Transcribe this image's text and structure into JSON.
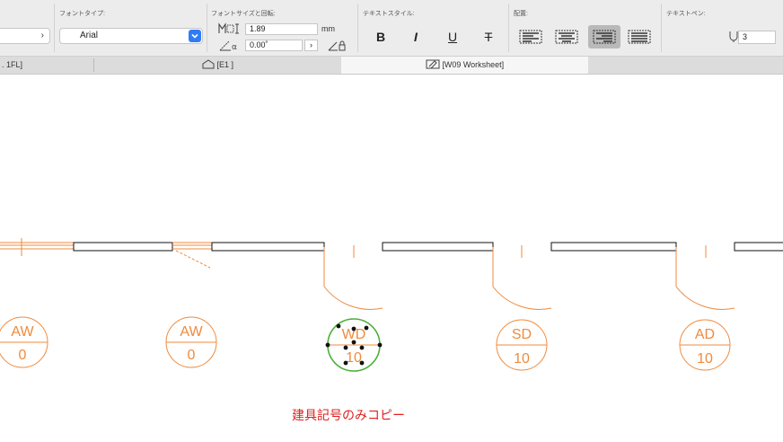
{
  "toolbar": {
    "font_type_label": "フォントタイプ:",
    "font_value": "Arial",
    "font_size_label": "フォントサイズと回転:",
    "font_size_value": "1.89",
    "font_size_unit": "mm",
    "rotation_value": "0.00˚",
    "text_style_label": "テキストスタイル:",
    "style_bold": "B",
    "style_italic": "I",
    "style_underline": "U",
    "style_strike": "T",
    "alignment_label": "配置:",
    "active_alignment": "right",
    "text_pen_label": "テキストペン:",
    "text_pen_value": "3"
  },
  "tabs": [
    {
      "label": ". 1FL]",
      "icon": "floor-plan-icon"
    },
    {
      "label": "[E1 ]",
      "icon": "elevation-icon"
    },
    {
      "label": "[W09 Worksheet]",
      "icon": "worksheet-icon",
      "active": true
    }
  ],
  "drawing": {
    "markers": [
      {
        "top": "AW",
        "bottom": "0"
      },
      {
        "top": "AW",
        "bottom": "0"
      },
      {
        "top": "WD",
        "bottom": "10",
        "selected": true
      },
      {
        "top": "SD",
        "bottom": "10"
      },
      {
        "top": "AD",
        "bottom": "10"
      }
    ],
    "caption": "建具記号のみコピー",
    "colors": {
      "line": "#f08a3c",
      "selection": "#4caf3a",
      "caption": "#e02020"
    }
  }
}
